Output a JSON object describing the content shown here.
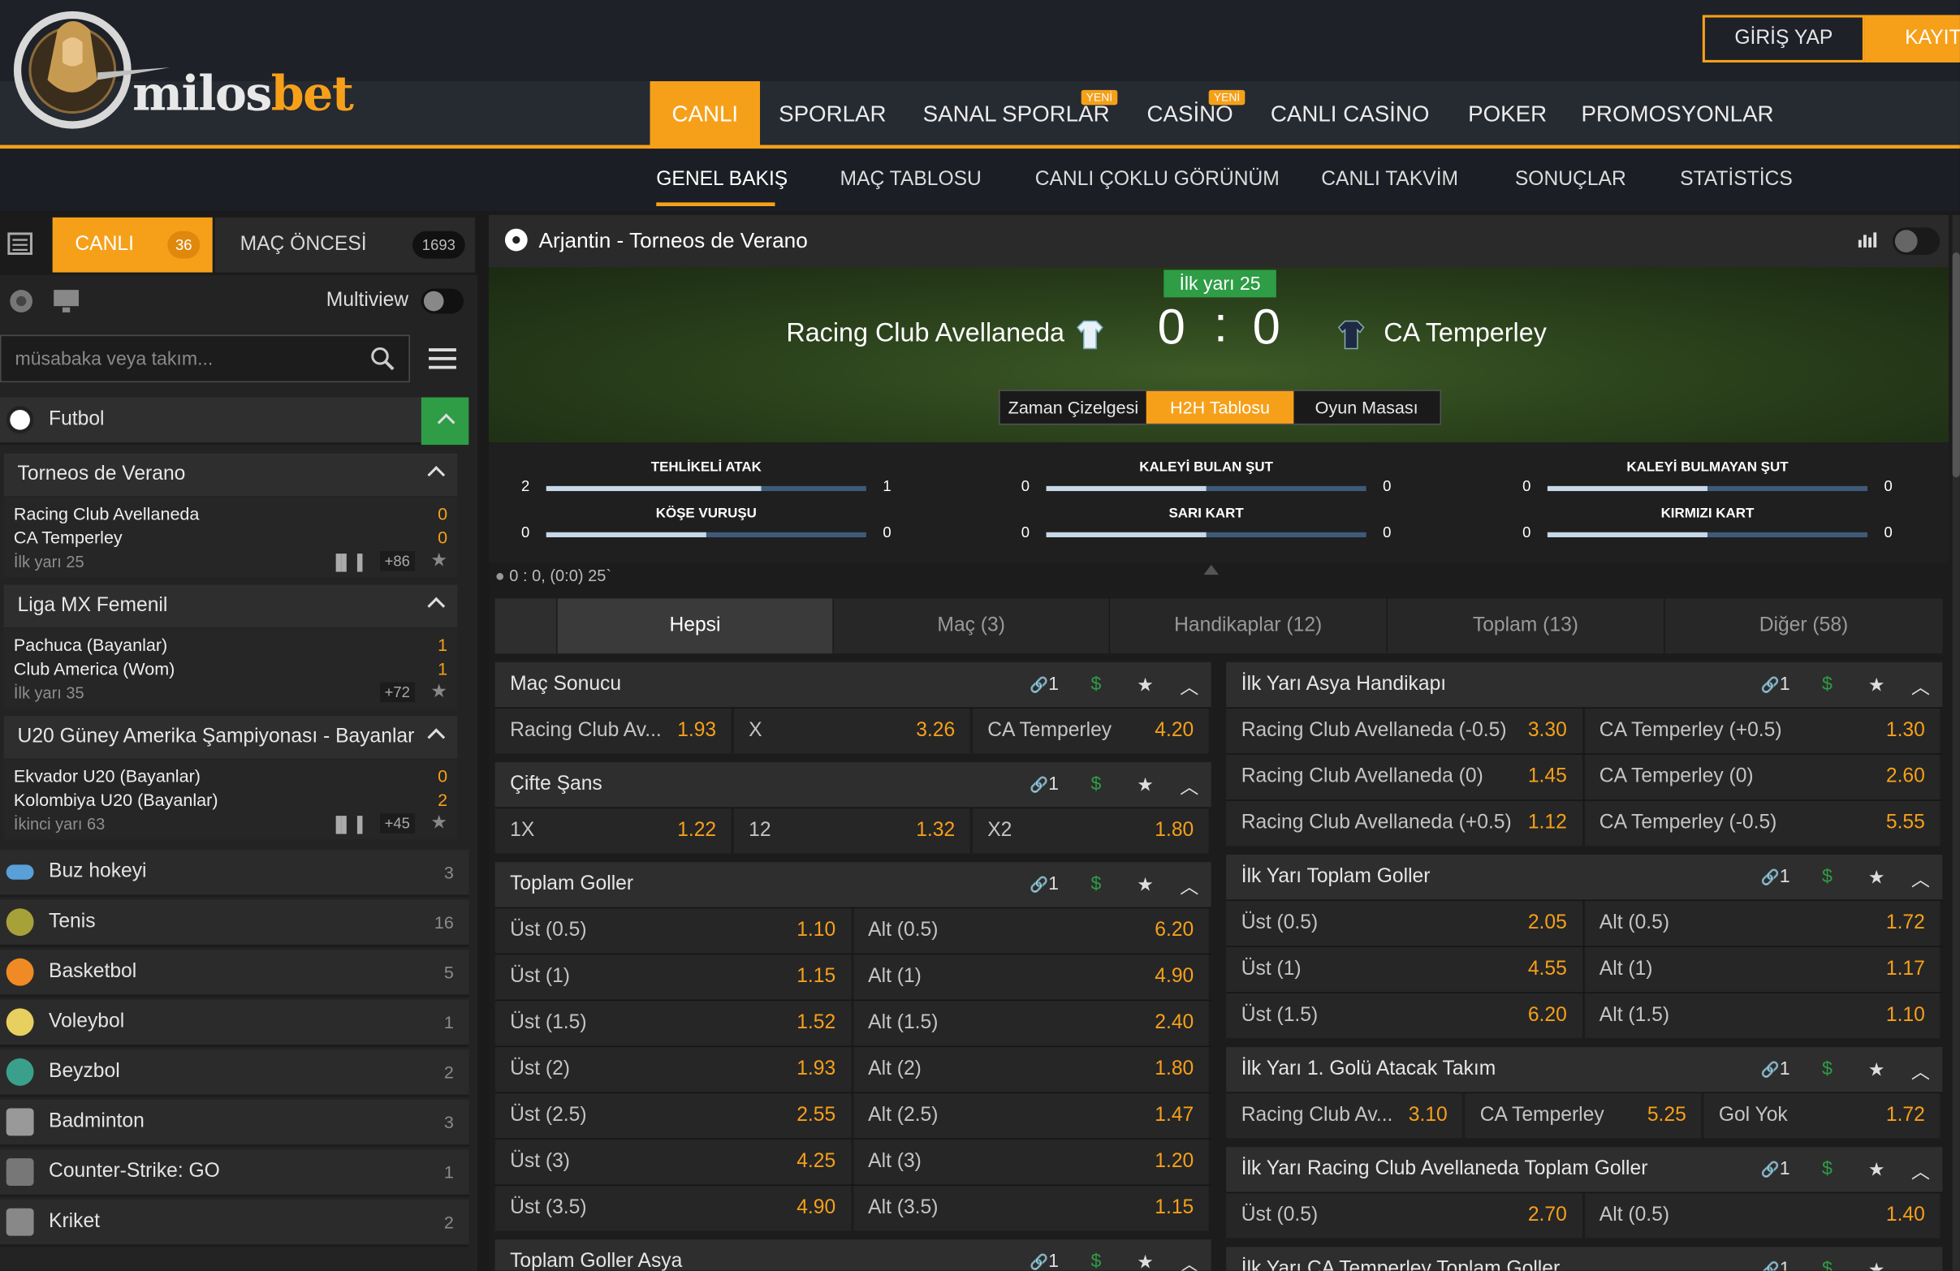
{
  "brand": {
    "name_a": "milos",
    "name_b": "bet"
  },
  "auth": {
    "login": "GİRİŞ YAP",
    "register": "KAYIT"
  },
  "topnav": [
    {
      "label": "CANLI",
      "active": true
    },
    {
      "label": "SPORLAR"
    },
    {
      "label": "SANAL SPORLAR",
      "badge": "YENİ"
    },
    {
      "label": "CASİNO",
      "badge": "YENİ"
    },
    {
      "label": "CANLI CASİNO"
    },
    {
      "label": "POKER"
    },
    {
      "label": "PROMOSYONLAR"
    }
  ],
  "subnav": [
    "GENEL BAKIŞ",
    "MAÇ TABLOSU",
    "CANLI ÇOKLU GÖRÜNÜM",
    "CANLI TAKVİM",
    "SONUÇLAR",
    "STATİSTİCS"
  ],
  "sidebar": {
    "tab_live": "CANLI",
    "tab_live_count": "36",
    "tab_pre": "MAÇ ÖNCESİ",
    "tab_pre_count": "1693",
    "multiview": "Multiview",
    "search_placeholder": "müsabaka veya takım...",
    "sport_open": "Futbol",
    "leagues": [
      {
        "name": "Torneos de Verano",
        "home": "Racing Club Avellaneda",
        "away": "CA Temperley",
        "hs": "0",
        "as": "0",
        "period": "İlk yarı  25",
        "more": "+86"
      },
      {
        "name": "Liga MX Femenil",
        "home": "Pachuca (Bayanlar)",
        "away": "Club America (Wom)",
        "hs": "1",
        "as": "1",
        "period": "İlk yarı  35",
        "more": "+72"
      },
      {
        "name": "U20 Güney Amerika Şampiyonası - Bayanlar",
        "home": "Ekvador U20 (Bayanlar)",
        "away": "Kolombiya U20 (Bayanlar)",
        "hs": "0",
        "as": "2",
        "period": "İkinci yarı  63",
        "more": "+45"
      }
    ],
    "sports": [
      {
        "name": "Buz hokeyi",
        "count": "3"
      },
      {
        "name": "Tenis",
        "count": "16"
      },
      {
        "name": "Basketbol",
        "count": "5"
      },
      {
        "name": "Voleybol",
        "count": "1"
      },
      {
        "name": "Beyzbol",
        "count": "2"
      },
      {
        "name": "Badminton",
        "count": "3"
      },
      {
        "name": "Counter-Strike: GO",
        "count": "1"
      },
      {
        "name": "Kriket",
        "count": "2"
      }
    ]
  },
  "event": {
    "title": "Arjantin - Torneos de Verano",
    "period": "İlk yarı 25",
    "home": "Racing Club Avellaneda",
    "away": "CA Temperley",
    "home_score": "0",
    "away_score": "0",
    "sep": ":",
    "views": [
      "Zaman Çizelgesi",
      "H2H Tablosu",
      "Oyun Masası"
    ],
    "stats": [
      {
        "label": "TEHLİKELİ ATAK",
        "a": "2",
        "b": "1",
        "share": 0.67
      },
      {
        "label": "KALEYİ BULAN ŞUT",
        "a": "0",
        "b": "0",
        "share": 0.5
      },
      {
        "label": "KALEYİ BULMAYAN ŞUT",
        "a": "0",
        "b": "0",
        "share": 0.5
      },
      {
        "label": "KÖŞE VURUŞU",
        "a": "0",
        "b": "0",
        "share": 0.5
      },
      {
        "label": "SARI KART",
        "a": "0",
        "b": "0",
        "share": 0.5
      },
      {
        "label": "KIRMIZI KART",
        "a": "0",
        "b": "0",
        "share": 0.5
      }
    ],
    "live_line": "0 : 0, (0:0) 25`"
  },
  "market_tabs": [
    "Hepsi",
    "Maç (3)",
    "Handikaplar (12)",
    "Toplam (13)",
    "Diğer (58)"
  ],
  "left_markets": [
    {
      "title": "Maç Sonucu",
      "rows": [
        [
          [
            "Racing Club Av...",
            "1.93"
          ],
          [
            "X",
            "3.26"
          ],
          [
            "CA Temperley",
            "4.20"
          ]
        ]
      ]
    },
    {
      "title": "Çifte Şans",
      "rows": [
        [
          [
            "1X",
            "1.22"
          ],
          [
            "12",
            "1.32"
          ],
          [
            "X2",
            "1.80"
          ]
        ]
      ]
    },
    {
      "title": "Toplam Goller",
      "rows": [
        [
          [
            "Üst (0.5)",
            "1.10"
          ],
          [
            "Alt (0.5)",
            "6.20"
          ]
        ],
        [
          [
            "Üst (1)",
            "1.15"
          ],
          [
            "Alt (1)",
            "4.90"
          ]
        ],
        [
          [
            "Üst (1.5)",
            "1.52"
          ],
          [
            "Alt (1.5)",
            "2.40"
          ]
        ],
        [
          [
            "Üst (2)",
            "1.93"
          ],
          [
            "Alt (2)",
            "1.80"
          ]
        ],
        [
          [
            "Üst (2.5)",
            "2.55"
          ],
          [
            "Alt (2.5)",
            "1.47"
          ]
        ],
        [
          [
            "Üst (3)",
            "4.25"
          ],
          [
            "Alt (3)",
            "1.20"
          ]
        ],
        [
          [
            "Üst (3.5)",
            "4.90"
          ],
          [
            "Alt (3.5)",
            "1.15"
          ]
        ]
      ]
    },
    {
      "title": "Toplam Goller Asya",
      "rows": []
    }
  ],
  "right_markets": [
    {
      "title": "İlk Yarı Asya Handikapı",
      "rows": [
        [
          [
            "Racing Club Avellaneda (-0.5)",
            "3.30"
          ],
          [
            "CA Temperley (+0.5)",
            "1.30"
          ]
        ],
        [
          [
            "Racing Club Avellaneda (0)",
            "1.45"
          ],
          [
            "CA Temperley (0)",
            "2.60"
          ]
        ],
        [
          [
            "Racing Club Avellaneda (+0.5)",
            "1.12"
          ],
          [
            "CA Temperley (-0.5)",
            "5.55"
          ]
        ]
      ]
    },
    {
      "title": "İlk Yarı Toplam Goller",
      "rows": [
        [
          [
            "Üst (0.5)",
            "2.05"
          ],
          [
            "Alt (0.5)",
            "1.72"
          ]
        ],
        [
          [
            "Üst (1)",
            "4.55"
          ],
          [
            "Alt (1)",
            "1.17"
          ]
        ],
        [
          [
            "Üst (1.5)",
            "6.20"
          ],
          [
            "Alt (1.5)",
            "1.10"
          ]
        ]
      ]
    },
    {
      "title": "İlk Yarı 1. Golü Atacak Takım",
      "rows": [
        [
          [
            "Racing Club Av...",
            "3.10"
          ],
          [
            "CA Temperley",
            "5.25"
          ],
          [
            "Gol Yok",
            "1.72"
          ]
        ]
      ]
    },
    {
      "title": "İlk Yarı Racing Club Avellaneda Toplam Goller",
      "rows": [
        [
          [
            "Üst (0.5)",
            "2.70"
          ],
          [
            "Alt (0.5)",
            "1.40"
          ]
        ]
      ]
    },
    {
      "title": "İlk Yarı CA Temperley Toplam Goller",
      "rows": []
    }
  ],
  "link_count": "1",
  "colors": {
    "accent": "#f6a01a",
    "green": "#2e9d45"
  }
}
